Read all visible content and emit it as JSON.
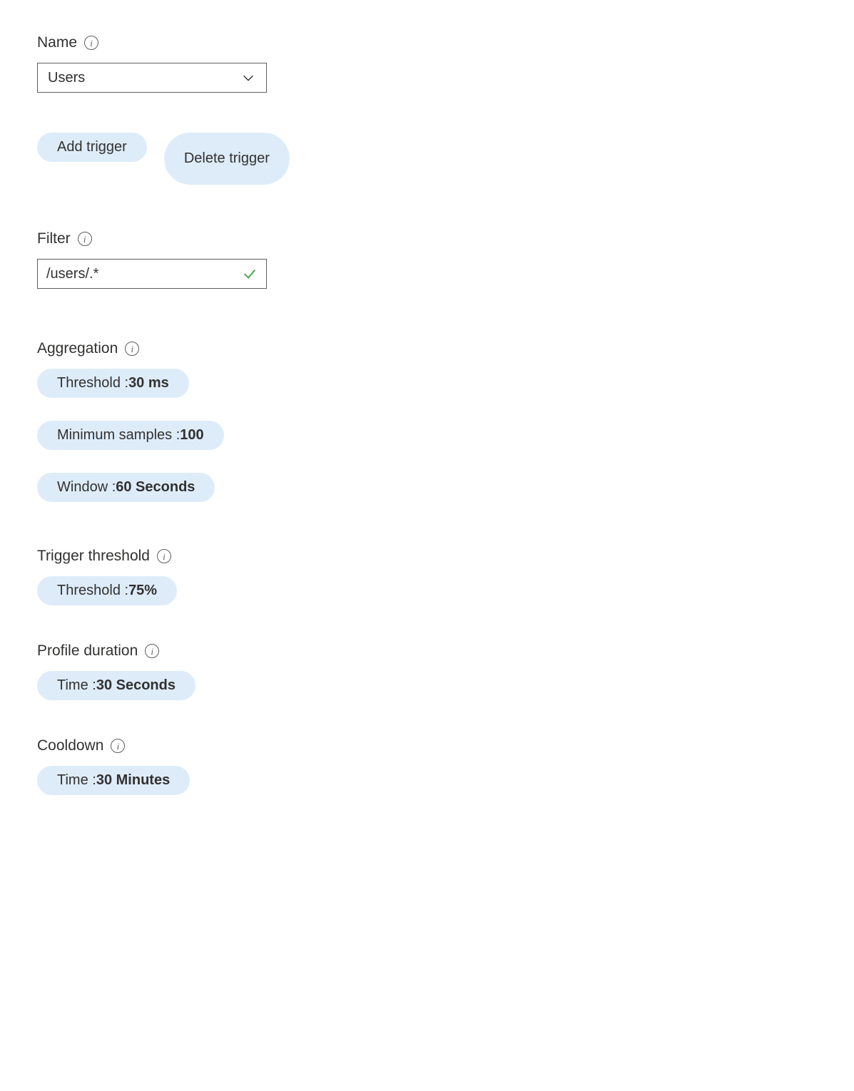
{
  "name": {
    "label": "Name",
    "value": "Users"
  },
  "buttons": {
    "add_trigger": "Add trigger",
    "delete_trigger": "Delete trigger"
  },
  "filter": {
    "label": "Filter",
    "value": "/users/.*"
  },
  "aggregation": {
    "label": "Aggregation",
    "threshold": {
      "key": "Threshold : ",
      "value": "30 ms"
    },
    "min_samples": {
      "key": "Minimum samples : ",
      "value": "100"
    },
    "window": {
      "key": "Window : ",
      "value": "60 Seconds"
    }
  },
  "trigger_threshold": {
    "label": "Trigger threshold",
    "threshold": {
      "key": "Threshold : ",
      "value": "75%"
    }
  },
  "profile_duration": {
    "label": "Profile duration",
    "time": {
      "key": "Time : ",
      "value": "30 Seconds"
    }
  },
  "cooldown": {
    "label": "Cooldown",
    "time": {
      "key": "Time : ",
      "value": "30 Minutes"
    }
  }
}
